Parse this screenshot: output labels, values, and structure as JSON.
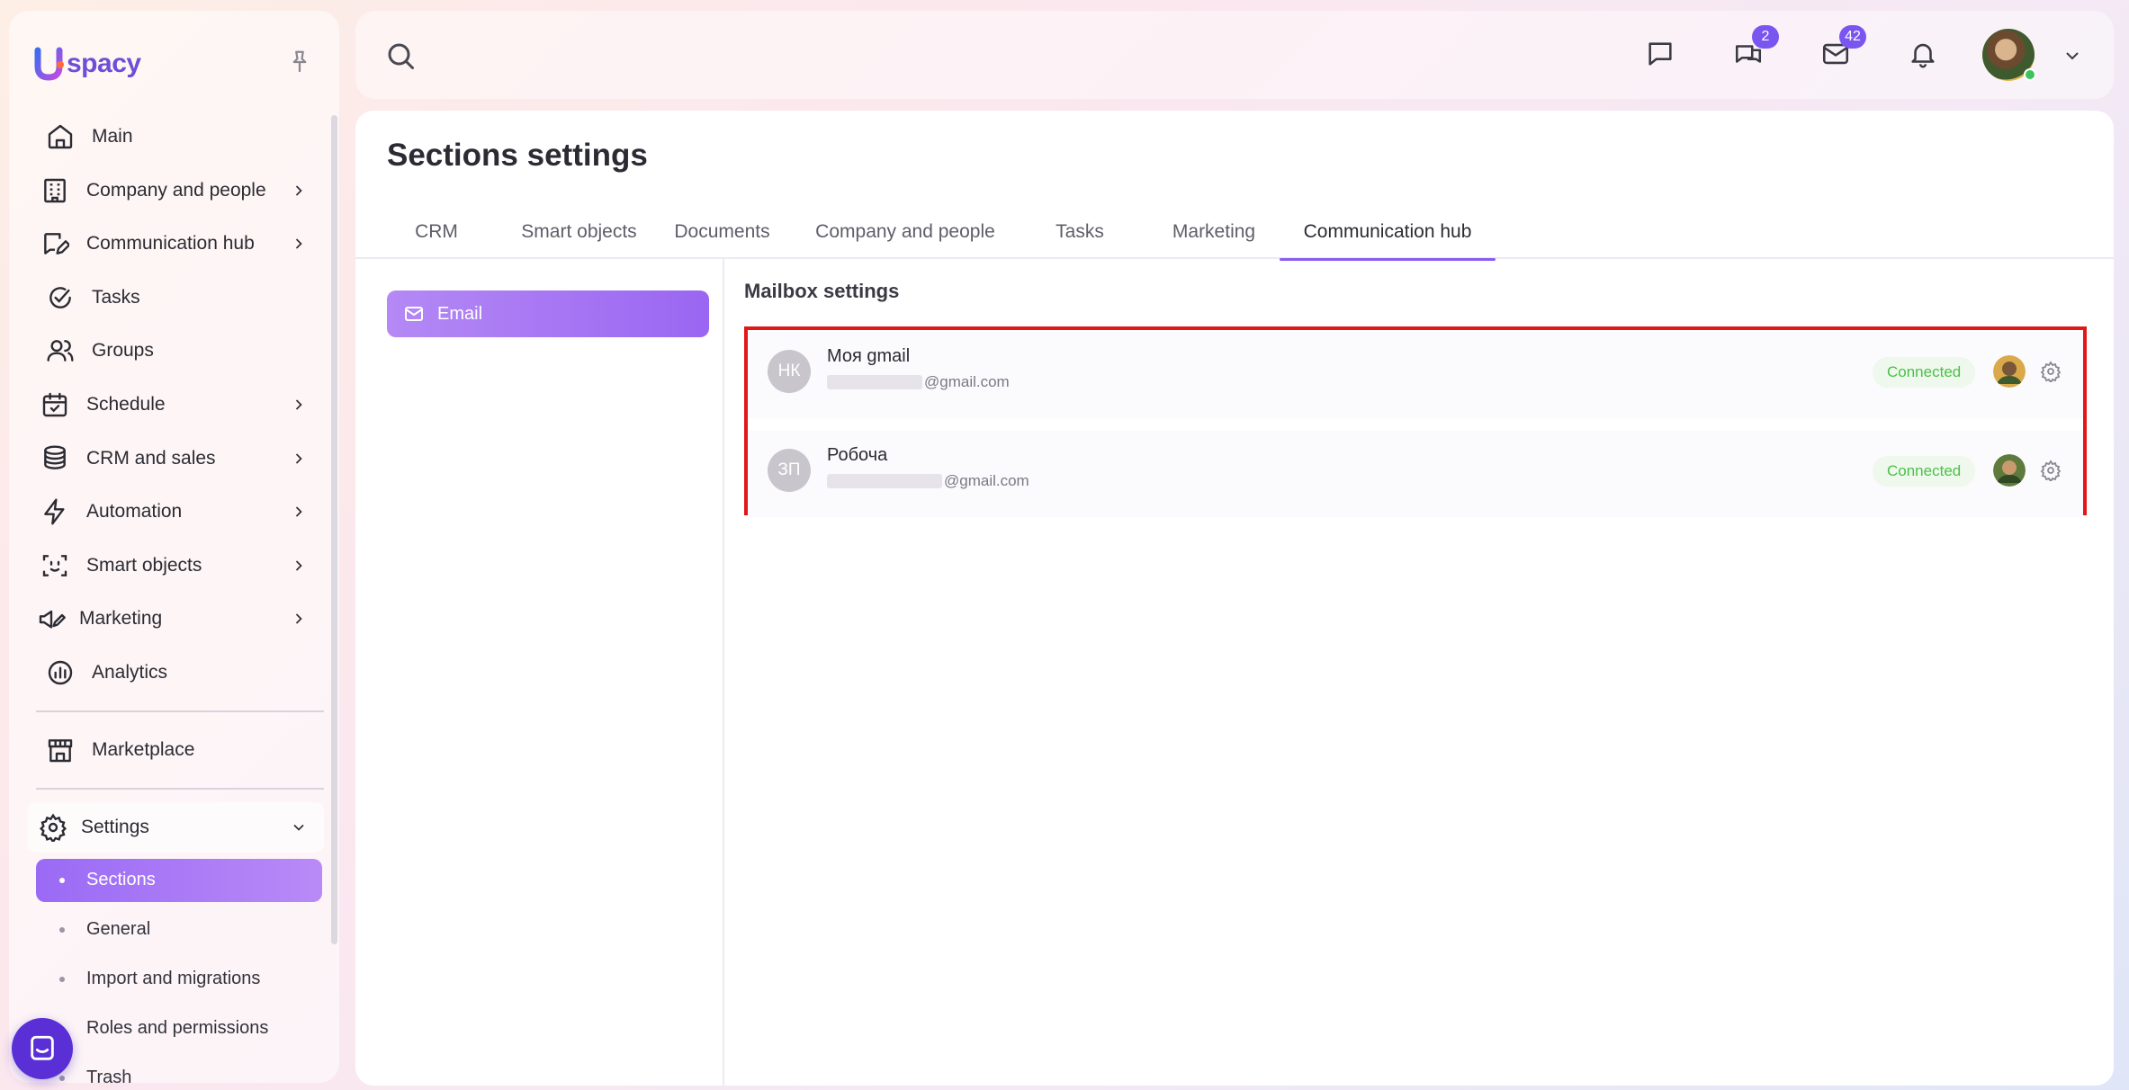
{
  "brand": {
    "logo_text": "spacy"
  },
  "sidebar": {
    "items": [
      {
        "label": "Main",
        "icon": "home-icon",
        "has_chevron": false
      },
      {
        "label": "Company and people",
        "icon": "building-icon",
        "has_chevron": true
      },
      {
        "label": "Communication hub",
        "icon": "chat-edit-icon",
        "has_chevron": true
      },
      {
        "label": "Tasks",
        "icon": "check-circle-icon",
        "has_chevron": false
      },
      {
        "label": "Groups",
        "icon": "users-icon",
        "has_chevron": false
      },
      {
        "label": "Schedule",
        "icon": "calendar-check-icon",
        "has_chevron": true
      },
      {
        "label": "CRM and sales",
        "icon": "coins-stack-icon",
        "has_chevron": true
      },
      {
        "label": "Automation",
        "icon": "lightning-icon",
        "has_chevron": true
      },
      {
        "label": "Smart objects",
        "icon": "scan-face-icon",
        "has_chevron": true
      },
      {
        "label": "Marketing",
        "icon": "megaphone-edit-icon",
        "has_chevron": true
      },
      {
        "label": "Analytics",
        "icon": "chart-circle-icon",
        "has_chevron": false
      }
    ],
    "marketplace": {
      "label": "Marketplace",
      "icon": "store-icon"
    },
    "settings": {
      "label": "Settings",
      "icon": "gear-icon",
      "subitems": [
        {
          "label": "Sections",
          "active": true
        },
        {
          "label": "General",
          "active": false
        },
        {
          "label": "Import and migrations",
          "active": false
        },
        {
          "label": "Roles and permissions",
          "active": false
        },
        {
          "label": "Trash",
          "active": false
        }
      ]
    }
  },
  "topbar": {
    "chat_badge": "2",
    "mail_badge": "42"
  },
  "page": {
    "title": "Sections settings",
    "tabs": [
      {
        "label": "CRM",
        "active": false
      },
      {
        "label": "Smart objects",
        "active": false
      },
      {
        "label": "Documents",
        "active": false
      },
      {
        "label": "Company and people",
        "active": false
      },
      {
        "label": "Tasks",
        "active": false
      },
      {
        "label": "Marketing",
        "active": false
      },
      {
        "label": "Communication hub",
        "active": true
      }
    ],
    "left_nav": {
      "email_label": "Email"
    },
    "mailbox": {
      "title": "Mailbox settings",
      "rows": [
        {
          "initials": "НК",
          "name": "Моя gmail",
          "email_suffix": "@gmail.com",
          "status": "Connected"
        },
        {
          "initials": "ЗП",
          "name": "Робоча",
          "email_suffix": "@gmail.com",
          "status": "Connected"
        }
      ]
    }
  },
  "colors": {
    "accent": "#8a5cf0",
    "status_connected": "#4cc04a",
    "highlight_border": "#e01818",
    "chat_bubble": "#5a2fd6"
  }
}
